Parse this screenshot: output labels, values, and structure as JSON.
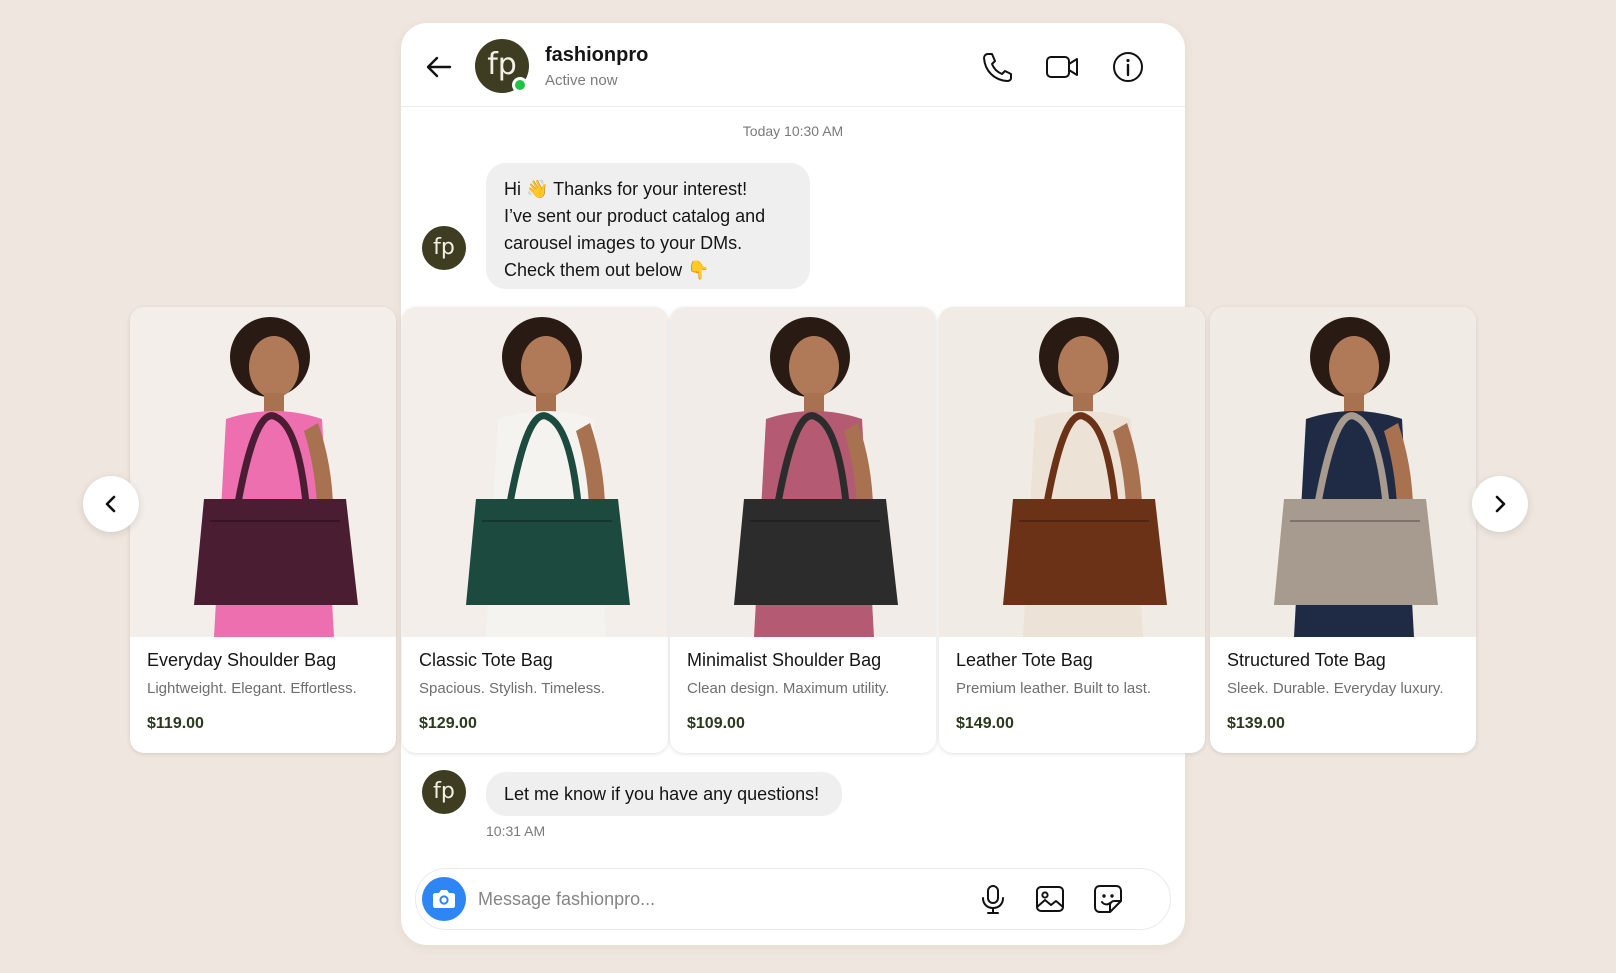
{
  "header": {
    "avatar_initials": "fp",
    "name": "fashionpro",
    "status": "Active now"
  },
  "chat": {
    "timestamp": "Today 10:30 AM",
    "message1": [
      "Hi 👋 Thanks for your interest!",
      "I’ve sent our product catalog and",
      "carousel images to your DMs.",
      "Check them out below 👇"
    ],
    "message2": "Let me know if you have any questions!",
    "message2_time": "10:31 AM"
  },
  "products": [
    {
      "title": "Everyday Shoulder Bag",
      "desc": "Lightweight. Elegant. Effortless.",
      "price": "$119.00",
      "bag_color": "#4a1d33",
      "outfit_color": "#ee6fb0",
      "bg": "#f3eeea"
    },
    {
      "title": "Classic Tote Bag",
      "desc": "Spacious. Stylish. Timeless.",
      "price": "$129.00",
      "bag_color": "#1c4a3f",
      "outfit_color": "#f4f3ef",
      "bg": "#f3eeea"
    },
    {
      "title": "Minimalist Shoulder Bag",
      "desc": "Clean design. Maximum utility.",
      "price": "$109.00",
      "bag_color": "#2c2c2c",
      "outfit_color": "#b45a73",
      "bg": "#f2ece8"
    },
    {
      "title": "Leather Tote Bag",
      "desc": "Premium leather. Built to last.",
      "price": "$149.00",
      "bag_color": "#6b3218",
      "outfit_color": "#ece2d6",
      "bg": "#f1ebe5"
    },
    {
      "title": "Structured Tote Bag",
      "desc": "Sleek. Durable. Everyday luxury.",
      "price": "$139.00",
      "bag_color": "#a79a8e",
      "outfit_color": "#1f2b45",
      "bg": "#f1ebe6"
    }
  ],
  "composer": {
    "placeholder": "Message fashionpro..."
  },
  "colors": {
    "accent": "#2e86f5",
    "online": "#21c24a",
    "avatar": "#3e3d22"
  }
}
